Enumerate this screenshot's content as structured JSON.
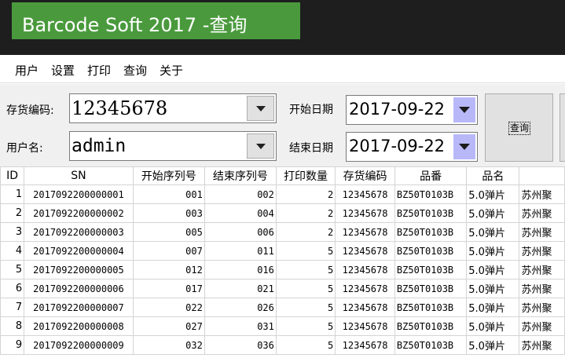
{
  "window": {
    "title": "Barcode Soft 2017 -查询"
  },
  "menu": [
    "用户",
    "设置",
    "打印",
    "查询",
    "关于"
  ],
  "form": {
    "item_code_label": "存货编码:",
    "item_code_value": "12345678",
    "user_label": "用户名:",
    "user_value": "admin",
    "start_date_label": "开始日期",
    "start_date_value": "2017-09-22",
    "end_date_label": "结束日期",
    "end_date_value": "2017-09-22",
    "query_button": "查询"
  },
  "table": {
    "columns": [
      "ID",
      "SN",
      "开始序列号",
      "结束序列号",
      "打印数量",
      "存货编码",
      "品番",
      "品名",
      ""
    ],
    "rows": [
      [
        "1",
        "2017092200000001",
        "001",
        "002",
        "2",
        "12345678",
        "BZ50T0103B",
        "5.0弹片",
        "苏州聚"
      ],
      [
        "2",
        "2017092200000002",
        "003",
        "004",
        "2",
        "12345678",
        "BZ50T0103B",
        "5.0弹片",
        "苏州聚"
      ],
      [
        "3",
        "2017092200000003",
        "005",
        "006",
        "2",
        "12345678",
        "BZ50T0103B",
        "5.0弹片",
        "苏州聚"
      ],
      [
        "4",
        "2017092200000004",
        "007",
        "011",
        "5",
        "12345678",
        "BZ50T0103B",
        "5.0弹片",
        "苏州聚"
      ],
      [
        "5",
        "2017092200000005",
        "012",
        "016",
        "5",
        "12345678",
        "BZ50T0103B",
        "5.0弹片",
        "苏州聚"
      ],
      [
        "6",
        "2017092200000006",
        "017",
        "021",
        "5",
        "12345678",
        "BZ50T0103B",
        "5.0弹片",
        "苏州聚"
      ],
      [
        "7",
        "2017092200000007",
        "022",
        "026",
        "5",
        "12345678",
        "BZ50T0103B",
        "5.0弹片",
        "苏州聚"
      ],
      [
        "8",
        "2017092200000008",
        "027",
        "031",
        "5",
        "12345678",
        "BZ50T0103B",
        "5.0弹片",
        "苏州聚"
      ],
      [
        "9",
        "2017092200000009",
        "032",
        "036",
        "5",
        "12345678",
        "BZ50T0103B",
        "5.0弹片",
        "苏州聚"
      ]
    ]
  },
  "colors": {
    "title_green": "#4a9a3d",
    "titlebar_dark": "#1e1e1e",
    "date_button": "#b8b8f8"
  }
}
